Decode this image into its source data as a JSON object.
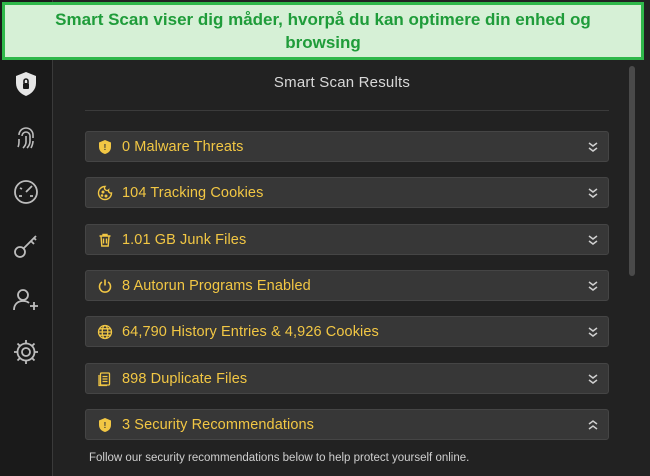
{
  "banner": {
    "text": "Smart Scan viser dig måder, hvorpå du kan optimere din enhed og browsing"
  },
  "sidebar": {
    "items": [
      {
        "icon": "shield-icon"
      },
      {
        "icon": "fingerprint-icon"
      },
      {
        "icon": "speedometer-icon"
      },
      {
        "icon": "key-icon"
      },
      {
        "icon": "add-user-icon"
      },
      {
        "icon": "gear-icon"
      }
    ]
  },
  "main": {
    "title": "Smart Scan Results",
    "results": [
      {
        "label": "0 Malware Threats",
        "icon": "shield-icon",
        "expanded": false
      },
      {
        "label": "104 Tracking Cookies",
        "icon": "cookie-icon",
        "expanded": false
      },
      {
        "label": "1.01 GB Junk Files",
        "icon": "trash-icon",
        "expanded": false
      },
      {
        "label": "8 Autorun Programs Enabled",
        "icon": "power-icon",
        "expanded": false
      },
      {
        "label": "64,790 History Entries & 4,926 Cookies",
        "icon": "globe-icon",
        "expanded": false
      },
      {
        "label": "898 Duplicate Files",
        "icon": "files-icon",
        "expanded": false
      },
      {
        "label": "3 Security Recommendations",
        "icon": "shield-icon",
        "expanded": true
      }
    ],
    "footer_text": "Follow our security recommendations below to help protect yourself online."
  },
  "colors": {
    "accent": "#f2c744",
    "banner_green": "#2fb84a",
    "background": "#222222"
  }
}
